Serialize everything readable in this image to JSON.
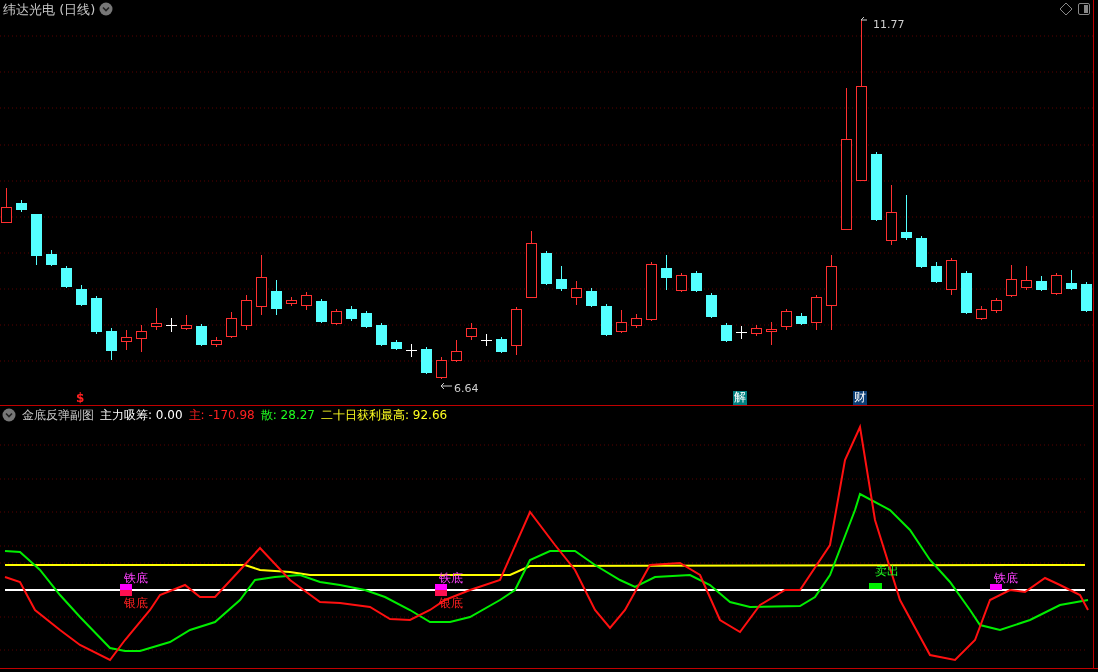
{
  "title": "纬达光电 (日线)",
  "price_labels": [
    {
      "kind": "high",
      "text": "11.77"
    },
    {
      "kind": "low",
      "text": "6.64"
    }
  ],
  "event_markers": [
    {
      "kind": "dollar",
      "text": "$",
      "color": "#ff2020"
    },
    {
      "kind": "badge",
      "text": "解",
      "color": "#008080"
    },
    {
      "kind": "badge",
      "text": "财",
      "color": "#0b3d73"
    }
  ],
  "indicator": {
    "name": "金底反弹副图",
    "readings": [
      {
        "text": "主力吸筹: 0.00",
        "color": "#ffffff"
      },
      {
        "text": "主: -170.98",
        "color": "#ff2020"
      },
      {
        "text": "散: 28.27",
        "color": "#20ff20"
      },
      {
        "text": "二十日获利最高: 92.66",
        "color": "#ffff20"
      }
    ]
  },
  "signals": [
    {
      "kind": "iron",
      "text": "铁底"
    },
    {
      "kind": "silver",
      "text": "银底"
    },
    {
      "kind": "iron",
      "text": "铁底"
    },
    {
      "kind": "silver",
      "text": "银底"
    },
    {
      "kind": "sell",
      "text": "卖出"
    },
    {
      "kind": "iron",
      "text": "铁底"
    }
  ]
}
